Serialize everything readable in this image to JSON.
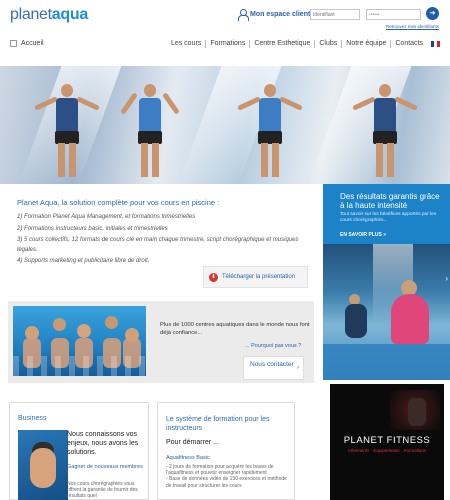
{
  "header": {
    "logo_main": "planet",
    "logo_accent": "aqua",
    "account_label": "Mon espace client",
    "username_placeholder": "Identifiant",
    "password_value": "••••••",
    "go_icon": "arrow-right-icon",
    "forgot_link": "Retrouvez mes identifiants"
  },
  "nav": {
    "home": "Accueil",
    "items": [
      "Les cours",
      "Formations",
      "Centre Esthetique",
      "Clubs",
      "Notre équipe",
      "Contacts"
    ],
    "flag_colors": [
      "#1f3f9a",
      "#ffffff",
      "#d8212a"
    ]
  },
  "intro": {
    "title": "Planet Aqua, la solution complète pour vos cours en piscine :",
    "points": [
      "1) Formation Planet Aqua Management, et formations trimestrielles",
      "2) Formations instructeurs basic, initiales et trimestrielles",
      "3) 5 cours collectifs, 12 formats de cours clé en main chaque trimestre, script chorégraphique et musiques légales.",
      "4) Supports marketing et publicitaire libre de droit."
    ],
    "download_label": "Télécharger la présentation",
    "pdf_icon": "pdf-icon"
  },
  "promo": {
    "title": "Des résultats garantis grâce à la haute intensité",
    "subtitle": "Tout savoir sur les bénéfices apportés par les cours chorégraphiés...",
    "more": "EN SAVOIR PLUS »"
  },
  "band": {
    "text": "Plus de 1000 centres aquatiques dans le monde nous font déjà confiance...",
    "link": "... Pourquoi pas vous ?",
    "contact_button": "Nous contacter"
  },
  "business": {
    "title": "Business",
    "headline": "Nous connaissons vos enjeux, nous avons les solutions.",
    "link": "Gagner de nouveaux membres",
    "desc": "Nos cours chorégraphiés vous offrent la garantie de fournir des résultats quel"
  },
  "training": {
    "title": "Le système de formation pour les instructeurs",
    "subtitle": "Pour démarrer ...",
    "link": "Aquafitness Basic",
    "desc": "- 2 jours de formation pour acquérir les bases de l'aquafitness et pouvoir enseigner rapidement\n- Base de données vidéo de 150 exercices et méthode de travail pour structurer les cours"
  },
  "ad": {
    "brand": "PLANET FITNESS",
    "tagline": "Vêtements · Equipements · Formations"
  }
}
